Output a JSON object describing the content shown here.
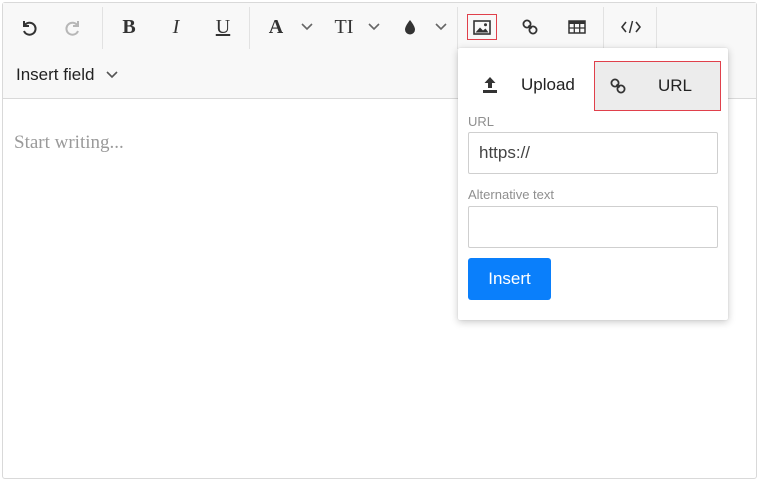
{
  "toolbar": {
    "undo_icon": "undo-icon",
    "redo_icon": "redo-icon",
    "bold_glyph": "B",
    "italic_glyph": "I",
    "underline_glyph": "U",
    "font_color_glyph": "A",
    "font_size_glyph": "TI",
    "insert_field_label": "Insert field"
  },
  "editor": {
    "placeholder": "Start writing..."
  },
  "image_popup": {
    "tabs": [
      {
        "label": "Upload",
        "icon": "upload-icon"
      },
      {
        "label": "URL",
        "icon": "link-icon",
        "selected": true
      }
    ],
    "url_label": "URL",
    "url_value": "https://",
    "alt_label": "Alternative text",
    "alt_value": "",
    "insert_label": "Insert"
  },
  "colors": {
    "accent": "#0a7ffb",
    "highlight_border": "#e0404b",
    "toolbar_bg": "#f8f8f8"
  }
}
